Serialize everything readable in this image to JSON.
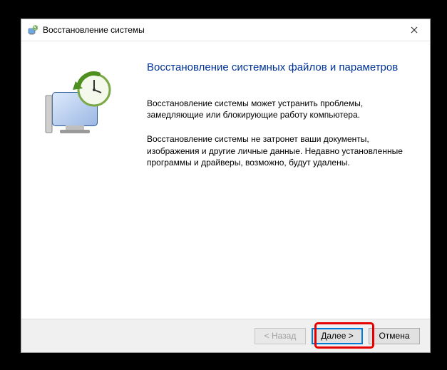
{
  "window": {
    "title": "Восстановление системы"
  },
  "content": {
    "heading": "Восстановление системных файлов и параметров",
    "para1": "Восстановление системы может устранить проблемы, замедляющие или блокирующие работу компьютера.",
    "para2": "Восстановление системы не затронет ваши документы, изображения и другие личные данные. Недавно установленные программы и драйверы, возможно, будут удалены."
  },
  "buttons": {
    "back": "< Назад",
    "next": "Далее >",
    "cancel": "Отмена"
  },
  "icons": {
    "title": "restore-icon",
    "close": "close-icon",
    "sidebar": "system-restore-illustration"
  }
}
